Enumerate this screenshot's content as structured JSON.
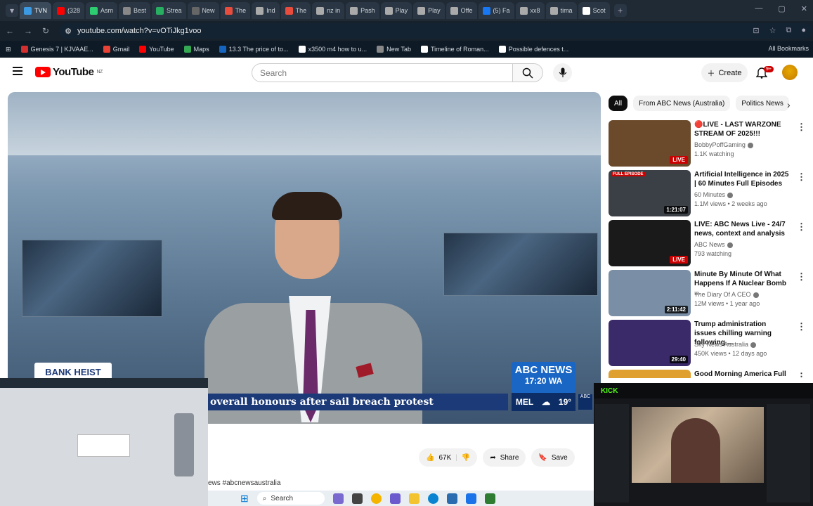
{
  "browser": {
    "tabs": [
      {
        "label": "TVN",
        "color": "#3b9ae1",
        "active": true
      },
      {
        "label": "(328",
        "color": "#ff0000"
      },
      {
        "label": "Asm",
        "color": "#2ecc71"
      },
      {
        "label": "Best",
        "color": "#888888"
      },
      {
        "label": "Strea",
        "color": "#27ae60"
      },
      {
        "label": "New",
        "color": "#666666"
      },
      {
        "label": "The",
        "color": "#e74c3c"
      },
      {
        "label": "Ind",
        "color": "#aaaaaa"
      },
      {
        "label": "The",
        "color": "#e74c3c"
      },
      {
        "label": "nz in",
        "color": "#aaaaaa"
      },
      {
        "label": "Pash",
        "color": "#aaaaaa"
      },
      {
        "label": "Play",
        "color": "#aaaaaa"
      },
      {
        "label": "Play",
        "color": "#aaaaaa"
      },
      {
        "label": "Offe",
        "color": "#aaaaaa"
      },
      {
        "label": "(5) Fa",
        "color": "#1877f2"
      },
      {
        "label": "xx8",
        "color": "#aaaaaa"
      },
      {
        "label": "tima",
        "color": "#aaaaaa"
      },
      {
        "label": "Scot",
        "color": "#ffffff"
      }
    ],
    "url": "youtube.com/watch?v=vOTiJkg1voo",
    "bookmarks": [
      {
        "label": "Genesis 7 | KJVAAE...",
        "color": "#d32f2f"
      },
      {
        "label": "Gmail",
        "color": "#ea4335"
      },
      {
        "label": "YouTube",
        "color": "#ff0000"
      },
      {
        "label": "Maps",
        "color": "#34a853"
      },
      {
        "label": "13.3 The price of to...",
        "color": "#1565c0"
      },
      {
        "label": "x3500 m4 how to u...",
        "color": "#ffffff"
      },
      {
        "label": "New Tab",
        "color": "#888888"
      },
      {
        "label": "Timeline of Roman...",
        "color": "#ffffff"
      },
      {
        "label": "Possible defences t...",
        "color": "#ffffff"
      }
    ],
    "all_bookmarks": "All Bookmarks"
  },
  "youtube": {
    "logo_text": "YouTube",
    "region": "NZ",
    "search_placeholder": "Search",
    "create_label": "Create",
    "notif_count": "9+",
    "video": {
      "ticker": "overall honours after sail breach protest",
      "bank_heist": "BANK HEIST",
      "abc_news": "ABC NEWS",
      "time": "17:20 WA",
      "city": "MEL",
      "temp": "19°",
      "likes": "67K",
      "share": "Share",
      "save": "Save",
      "hashtags": "ews #abcnewsaustralia"
    },
    "chips": [
      "All",
      "From ABC News (Australia)",
      "Politics News"
    ],
    "recommendations": [
      {
        "title": "🔴LIVE - LAST WARZONE STREAM OF 2025!!!",
        "channel": "BobbyPoffGaming",
        "meta": "1.1K watching",
        "badge": "LIVE",
        "thumb_color": "#6a4a2a"
      },
      {
        "title": "Artificial Intelligence in 2025 | 60 Minutes Full Episodes",
        "channel": "60 Minutes",
        "meta": "1.1M views • 2 weeks ago",
        "badge": "1:21:07",
        "label": "FULL EPISODE",
        "thumb_color": "#3b3f46"
      },
      {
        "title": "LIVE: ABC News Live - 24/7 news, context and analysis",
        "channel": "ABC News",
        "meta": "793 watching",
        "badge": "LIVE",
        "thumb_color": "#1a1a1a"
      },
      {
        "title": "Minute By Minute Of What Happens If A Nuclear Bomb ...",
        "channel": "The Diary Of A CEO",
        "meta": "12M views • 1 year ago",
        "badge": "2:11:42",
        "thumb_color": "#7a8fa6"
      },
      {
        "title": "Trump administration issues chilling warning following ...",
        "channel": "Sky News Australia",
        "meta": "450K views • 12 days ago",
        "badge": "29:40",
        "thumb_color": "#3a2a6a"
      },
      {
        "title": "Good Morning America Full",
        "channel": "",
        "meta": "",
        "badge": "",
        "thumb_color": "#e0a030"
      }
    ]
  },
  "taskbar": {
    "search": "Search"
  },
  "overlay": {
    "kick": "KICK"
  }
}
